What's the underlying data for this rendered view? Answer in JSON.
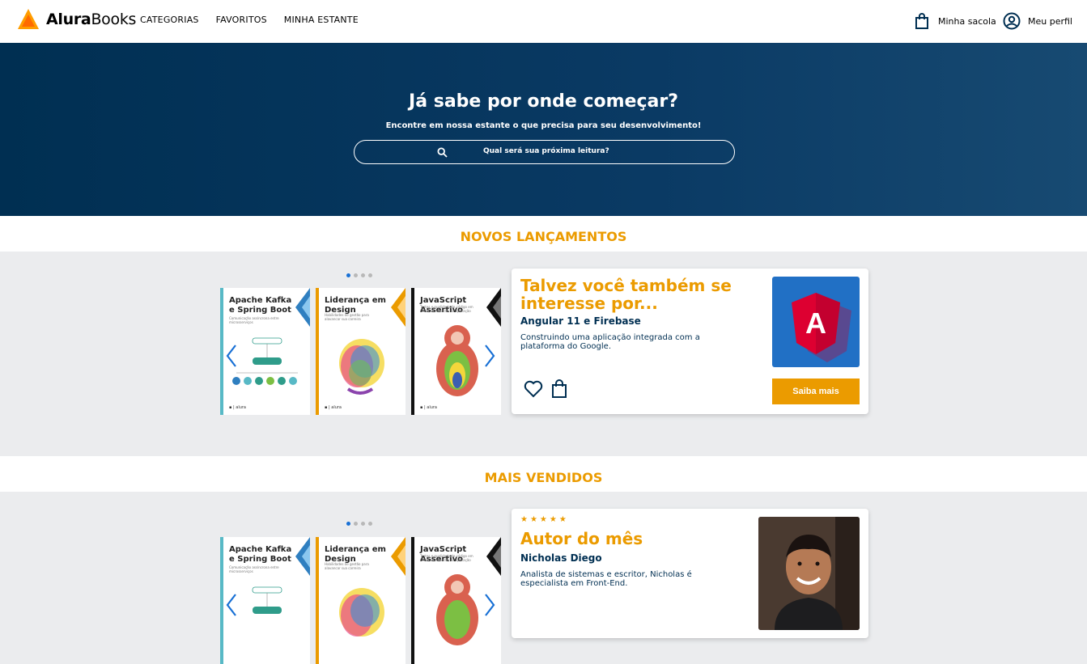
{
  "brand": {
    "name_bold": "Alura",
    "name_rest": "Books"
  },
  "nav": [
    "CATEGORIAS",
    "FAVORITOS",
    "MINHA ESTANTE"
  ],
  "header_right": {
    "bag": "Minha sacola",
    "profile": "Meu perfil"
  },
  "hero": {
    "title": "Já sabe por onde começar?",
    "subtitle": "Encontre em nossa estante o que precisa para seu desenvolvimento!",
    "search_placeholder": "Qual será sua próxima leitura?"
  },
  "sections": [
    {
      "title": "NOVOS LANÇAMENTOS",
      "card": {
        "heading": "Talvez você também se interesse por...",
        "book_title": "Angular 11 e Firebase",
        "description": "Construindo uma aplicação integrada com a plataforma do Google.",
        "button": "Saiba mais"
      }
    },
    {
      "title": "MAIS VENDIDOS",
      "card": {
        "stars": "★★★★★",
        "heading": "Autor do mês",
        "author": "Nicholas Diego",
        "description": "Analista de sistemas e escritor, Nicholas é especialista em Front-End."
      }
    }
  ],
  "books": [
    {
      "title": "Apache Kafka e Spring Boot",
      "subtitle": "Comunicação assíncrona entre microsserviços",
      "spine_color": "#58b9c6",
      "tag_color": "#2f7fc0"
    },
    {
      "title": "Liderança em Design",
      "subtitle": "Habilidades de gestão para alavancar sua carreira",
      "spine_color": "#eb9b00",
      "tag_color": "#eb9b00"
    },
    {
      "title": "JavaScript Assertivo",
      "subtitle": "Testes e qualidade de código em todas as camadas da aplicação",
      "spine_color": "#111111",
      "tag_color": "#111111"
    }
  ],
  "colors": {
    "accent": "#eb9b00",
    "navy": "#002f52",
    "dot_active": "#1870d5"
  }
}
